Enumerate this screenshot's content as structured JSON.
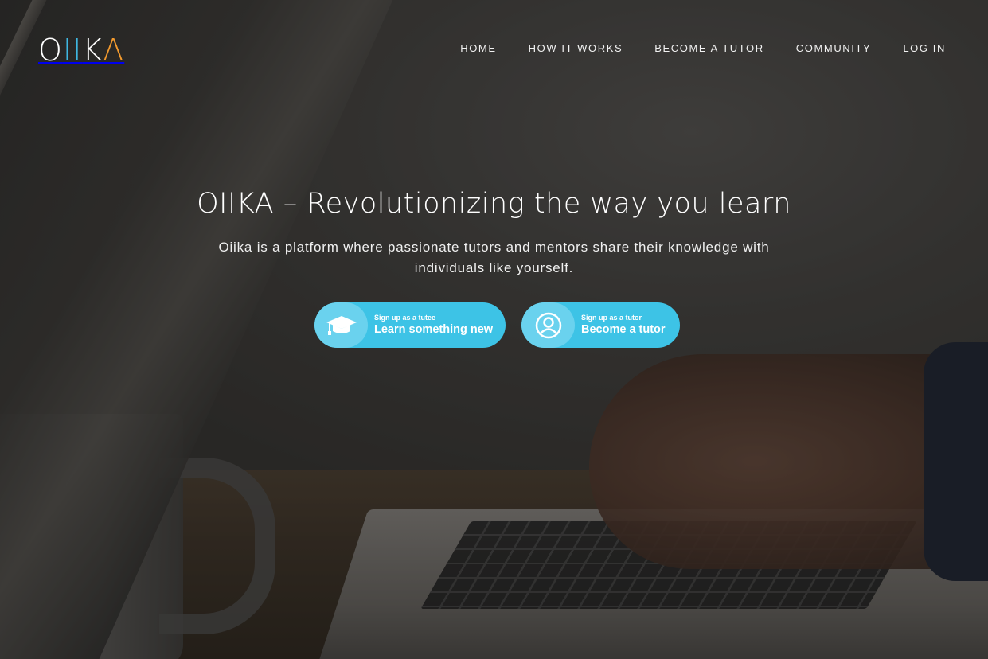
{
  "brand": {
    "logo_letters": [
      "O",
      "II",
      "K",
      "Λ"
    ],
    "colors": {
      "o": "#ffffff",
      "ii": "#3fb6e0",
      "k": "#ffffff",
      "a": "#f29a2e"
    }
  },
  "nav": {
    "items": [
      {
        "label": "HOME"
      },
      {
        "label": "HOW IT WORKS"
      },
      {
        "label": "BECOME A TUTOR"
      },
      {
        "label": "COMMUNITY"
      },
      {
        "label": "LOG IN"
      }
    ]
  },
  "hero": {
    "title_brand": "OIIKA",
    "title_rest": " – Revolutionizing the way you learn",
    "subtitle": "Oiika is a platform where passionate tutors and mentors share their knowledge with individuals like yourself."
  },
  "cta": {
    "tutee": {
      "small": "Sign up as a tutee",
      "big": "Learn something new",
      "icon": "graduation-cap-icon"
    },
    "tutor": {
      "small": "Sign up as a tutor",
      "big": "Become a tutor",
      "icon": "user-circle-icon"
    },
    "accent": "#3dc3e6"
  }
}
